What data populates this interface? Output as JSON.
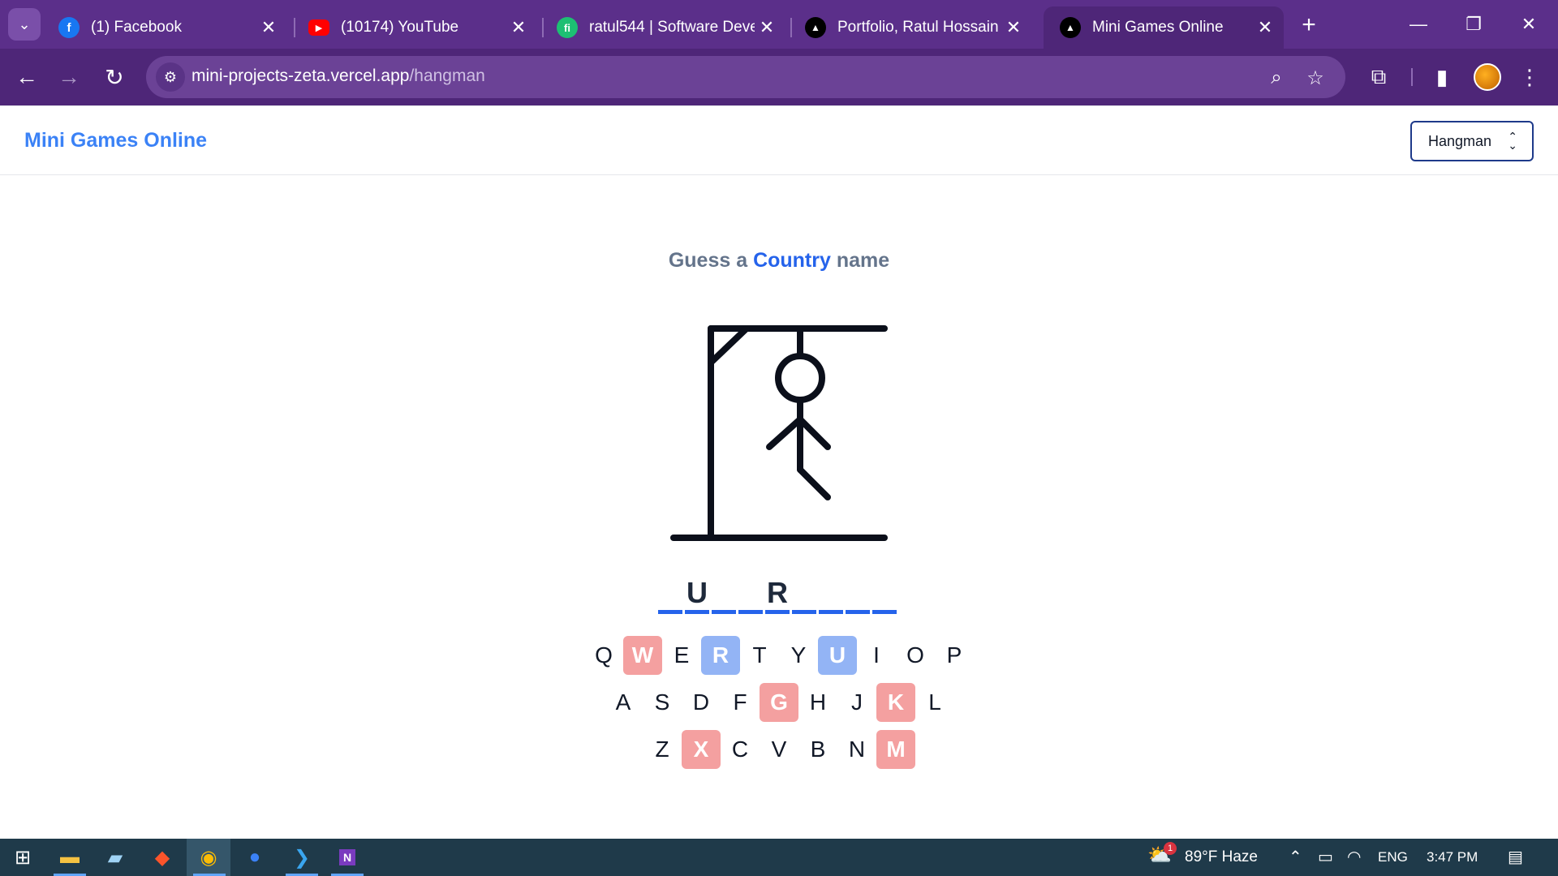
{
  "browser": {
    "tabs": [
      {
        "title": "(1) Facebook",
        "icon": "facebook-icon",
        "color": "#1877f2",
        "glyph": "f"
      },
      {
        "title": "(10174) YouTube",
        "icon": "youtube-icon",
        "color": "#ff0000",
        "glyph": "▶"
      },
      {
        "title": "ratul544 | Software Devel",
        "icon": "fiverr-icon",
        "color": "#1dbf73",
        "glyph": "fi"
      },
      {
        "title": "Portfolio, Ratul Hossain",
        "icon": "vercel-icon",
        "color": "#000000",
        "glyph": "▲"
      },
      {
        "title": "Mini Games Online",
        "icon": "vercel-icon",
        "color": "#000000",
        "glyph": "▲"
      }
    ],
    "active_tab_index": 4,
    "url_host": "mini-projects-zeta.vercel.app",
    "url_path": "/hangman"
  },
  "app": {
    "brand": "Mini Games Online",
    "game_select": {
      "selected": "Hangman"
    }
  },
  "game": {
    "prompt_prefix": "Guess a",
    "category": "Country",
    "prompt_suffix": "name",
    "word_slots": [
      "",
      "U",
      "",
      "",
      "R",
      "",
      "",
      "",
      ""
    ],
    "wrong_guess_count": 5,
    "keyboard_rows": [
      [
        "Q",
        "W",
        "E",
        "R",
        "T",
        "Y",
        "U",
        "I",
        "O",
        "P"
      ],
      [
        "A",
        "S",
        "D",
        "F",
        "G",
        "H",
        "J",
        "K",
        "L"
      ],
      [
        "Z",
        "X",
        "C",
        "V",
        "B",
        "N",
        "M"
      ]
    ],
    "wrong_letters": [
      "W",
      "G",
      "K",
      "X",
      "M"
    ],
    "correct_letters": [
      "R",
      "U"
    ]
  },
  "colors": {
    "brand": "#3b82f6",
    "category": "#2563eb",
    "wrong_key": "#f4a0a0",
    "correct_key": "#93b4f5",
    "chrome_frame": "#5b2f8a"
  },
  "taskbar": {
    "apps": [
      "windows-start-icon",
      "file-explorer-icon",
      "notepad-icon",
      "brave-icon",
      "chrome-icon",
      "firefox-icon",
      "vscode-icon",
      "onenote-icon"
    ],
    "weather_badge": "1",
    "weather": "89°F  Haze",
    "language": "ENG",
    "time": "3:47 PM"
  }
}
